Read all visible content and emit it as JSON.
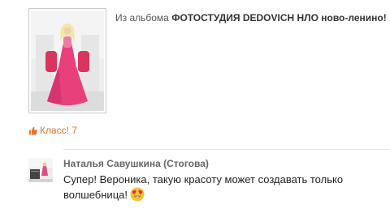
{
  "album": {
    "prefix": "Из альбома ",
    "name": "ФОТОСТУДИЯ DEDOVICH НЛО ново-ленино!"
  },
  "photo": {
    "icon": "photo-thumbnail",
    "dress_color": "#e8407a"
  },
  "klass": {
    "icon": "thumbs-up-icon",
    "label": "Класс! 7"
  },
  "comment": {
    "author": "Наталья Савушкина (Стогова)",
    "text": "Супер! Вероника, такую красоту может создавать только волшебница!",
    "emoji": "heart-eyes-emoji"
  },
  "colors": {
    "accent": "#eb722e",
    "divider": "#e3e3e3"
  }
}
